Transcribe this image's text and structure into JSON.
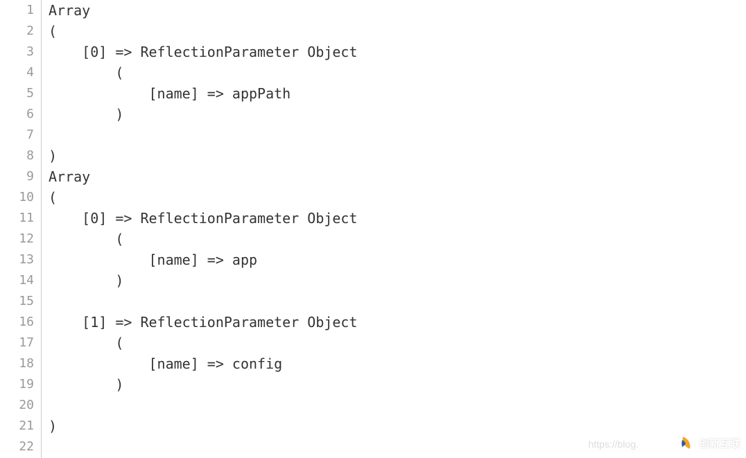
{
  "lineNumbers": [
    "1",
    "2",
    "3",
    "4",
    "5",
    "6",
    "7",
    "8",
    "9",
    "10",
    "11",
    "12",
    "13",
    "14",
    "15",
    "16",
    "17",
    "18",
    "19",
    "20",
    "21",
    "22"
  ],
  "codeLines": {
    "l1": "Array",
    "l2": "(",
    "l3": "    [0] => ReflectionParameter Object",
    "l4": "        (",
    "l5": "            [name] => appPath",
    "l6": "        )",
    "l7": "",
    "l8": ")",
    "l9": "Array",
    "l10": "(",
    "l11": "    [0] => ReflectionParameter Object",
    "l12": "        (",
    "l13": "            [name] => app",
    "l14": "        )",
    "l15": "",
    "l16": "    [1] => ReflectionParameter Object",
    "l17": "        (",
    "l18": "            [name] => config",
    "l19": "        )",
    "l20": "",
    "l21": ")",
    "l22": ""
  },
  "watermark": "https://blog.",
  "logoText": "创新互联"
}
